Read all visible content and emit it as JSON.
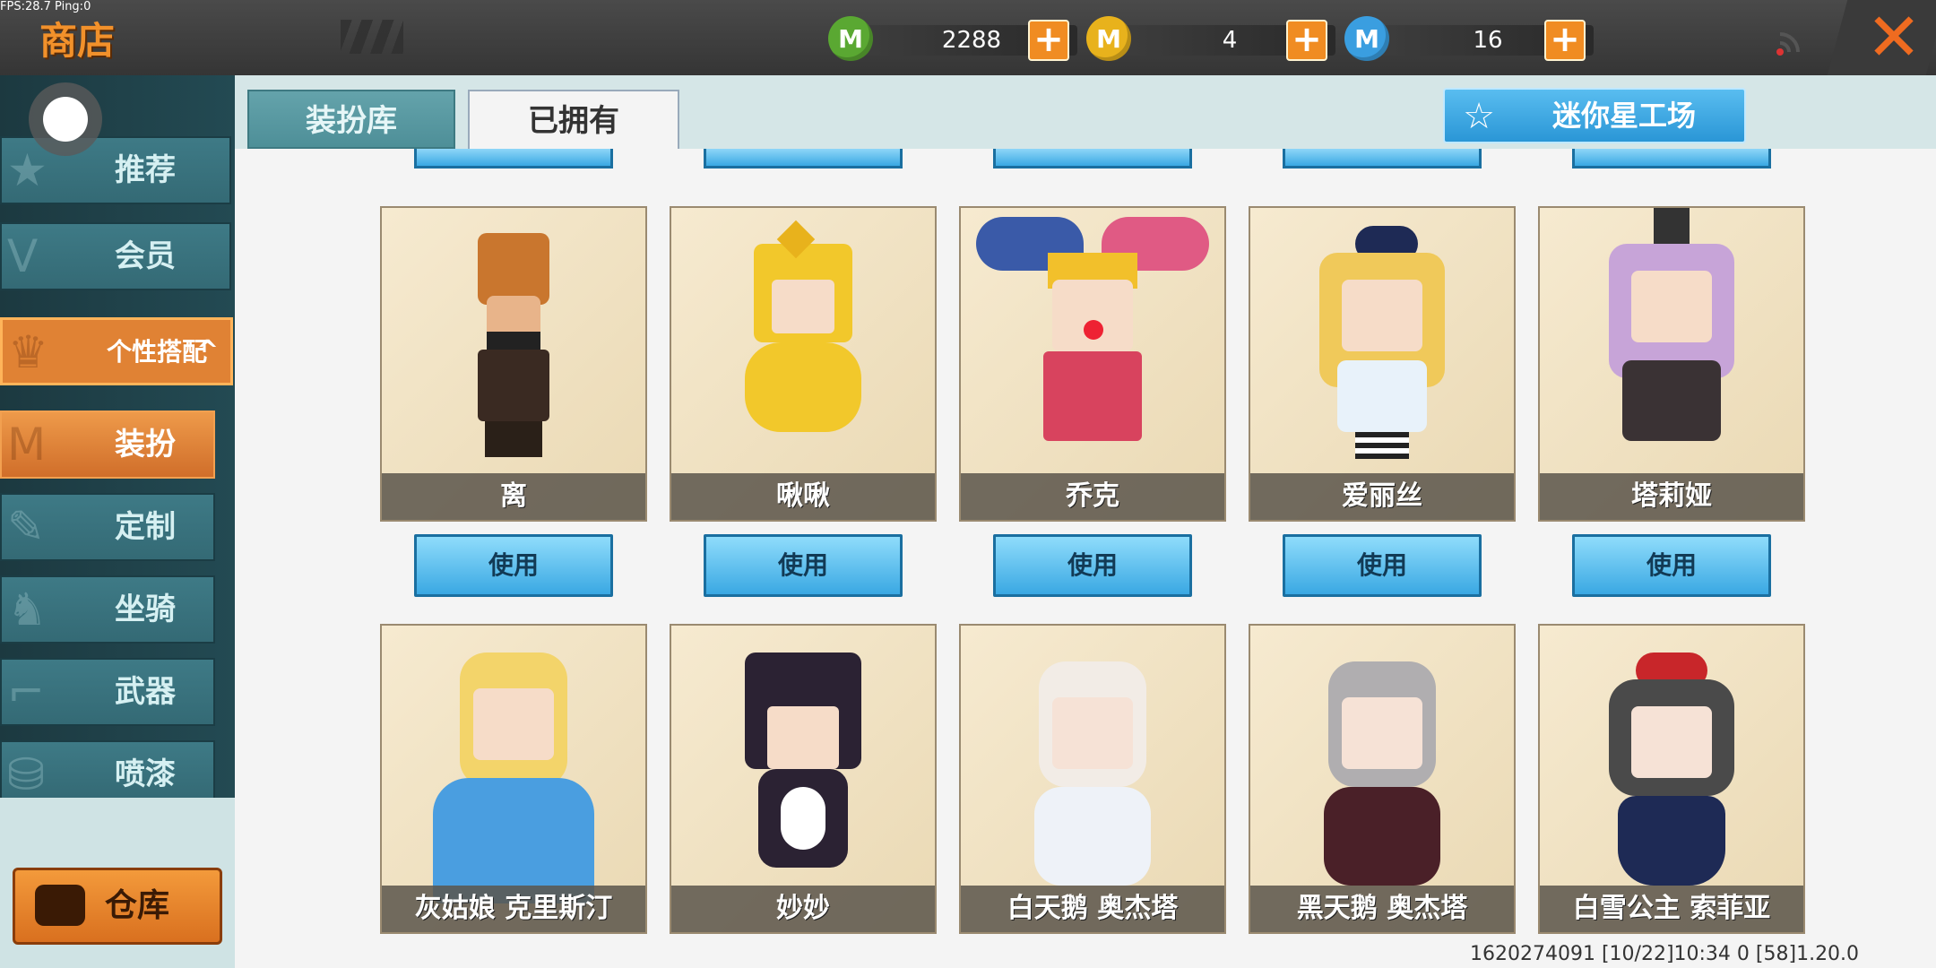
{
  "debug": {
    "fps_text": "FPS:28.7  Ping:0"
  },
  "header": {
    "title": "商店"
  },
  "currencies": [
    {
      "name": "green-coin",
      "value": "2288",
      "color": "#5aa832"
    },
    {
      "name": "gold-coin",
      "value": "4",
      "color": "#e8b21c"
    },
    {
      "name": "blue-coin",
      "value": "16",
      "color": "#3a9ee0"
    }
  ],
  "sidebar": {
    "items": [
      {
        "label": "推荐",
        "icon": "recommend-icon"
      },
      {
        "label": "会员",
        "icon": "vip-icon"
      },
      {
        "label": "个性搭配",
        "icon": "trophy-icon",
        "expanded_indicator": "^"
      },
      {
        "label": "装扮",
        "icon": "outfit-icon"
      },
      {
        "label": "定制",
        "icon": "pen-icon"
      },
      {
        "label": "坐骑",
        "icon": "mount-icon"
      },
      {
        "label": "武器",
        "icon": "gun-icon"
      },
      {
        "label": "喷漆",
        "icon": "spray-icon"
      }
    ],
    "warehouse_label": "仓库"
  },
  "tabs": [
    {
      "label": "装扮库",
      "active": false
    },
    {
      "label": "已拥有",
      "active": true
    }
  ],
  "workshop_button": {
    "label": "迷你星工场"
  },
  "cards_row1": [
    {
      "name": "离",
      "button": "使用",
      "accent": "#c9762e"
    },
    {
      "name": "啾啾",
      "button": "使用",
      "accent": "#f2c82b"
    },
    {
      "name": "乔克",
      "button": "使用",
      "accent": "#d8435e"
    },
    {
      "name": "爱丽丝",
      "button": "使用",
      "accent": "#f0c95a"
    },
    {
      "name": "塔莉娅",
      "button": "使用",
      "accent": "#c7a4d8"
    }
  ],
  "cards_row2": [
    {
      "name": "灰姑娘 克里斯汀",
      "accent": "#4a9ee0"
    },
    {
      "name": "妙妙",
      "accent": "#2b2233"
    },
    {
      "name": "白天鹅 奥杰塔",
      "accent": "#f2ece6"
    },
    {
      "name": "黑天鹅 奥杰塔",
      "accent": "#7a2a34"
    },
    {
      "name": "白雪公主 索菲亚",
      "accent": "#1e2a55"
    }
  ],
  "footer": {
    "version_text": "1620274091   [10/22]10:34 0   [58]1.20.0"
  }
}
